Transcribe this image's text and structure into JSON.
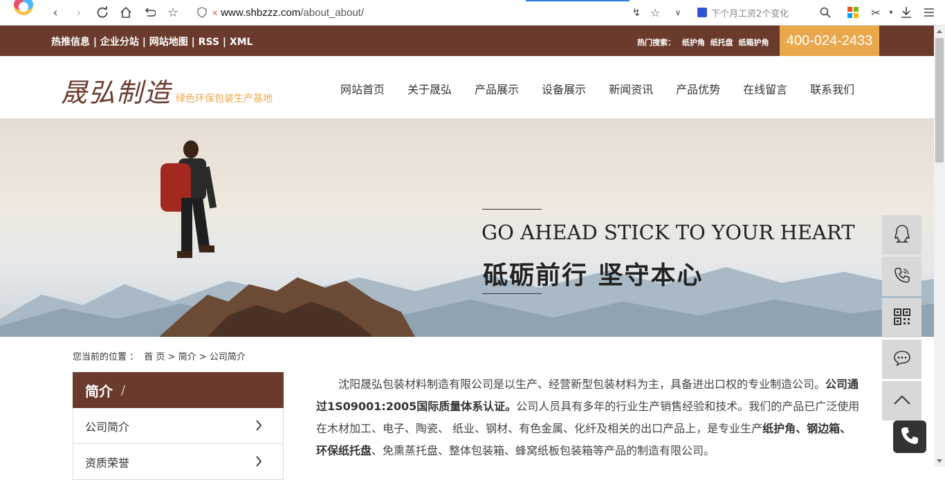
{
  "browser": {
    "url_host": "www.shbzzz.com",
    "url_path": "/about_about/",
    "search_placeholder": "下个月工资2个变化"
  },
  "topbar": {
    "links": [
      "热推信息",
      "企业分站",
      "网站地图",
      "RSS",
      "XML"
    ],
    "separator": " | ",
    "hot_label": "热门搜索：",
    "hot_terms": [
      "纸护角",
      "纸托盘",
      "纸箱护角"
    ],
    "phone": "400-024-2433"
  },
  "header": {
    "brand_script": "晟弘制造",
    "slogan": "绿色环保包装生产基地",
    "nav": [
      "网站首页",
      "关于晟弘",
      "产品展示",
      "设备展示",
      "新闻资讯",
      "产品优势",
      "在线留言",
      "联系我们"
    ]
  },
  "banner": {
    "english": "GO AHEAD STICK TO YOUR HEART",
    "chinese": "砥砺前行  坚守本心"
  },
  "breadcrumb": {
    "label": "您当前的位置 ：",
    "home": "首 页",
    "sep": ">",
    "section": "简介",
    "current": "公司简介"
  },
  "sidebar": {
    "title": "简介",
    "slash": "/",
    "items": [
      "公司简介",
      "资质荣誉"
    ]
  },
  "content": {
    "p1_a": "沈阳晟弘包装材料制造有限公司是以生产、经营新型包装材料为主，具备进出口权的专业制造公司。",
    "p1_b": "公司通过1S09001:2005国际质量体系认证。",
    "p1_c": "公司人员具有多年的行业生产销售经验和技术。我们的产品已广泛使用在木材加工、电子、陶瓷、 纸业、钢材、有色金属、化纤及相关的出口产品上，是专业生产",
    "p1_d": "纸护角、钢边箱、环保纸托盘",
    "p1_e": "、免熏蒸托盘、整体包装箱、蜂窝纸板包装箱等产品的制造有限公司。"
  },
  "colors": {
    "brand_brown": "#6a3b2c",
    "accent_orange": "#e9a84b"
  },
  "icons": [
    "qq-icon",
    "phone-call-icon",
    "qr-code-icon",
    "chat-icon",
    "back-to-top-icon",
    "phone-icon"
  ]
}
